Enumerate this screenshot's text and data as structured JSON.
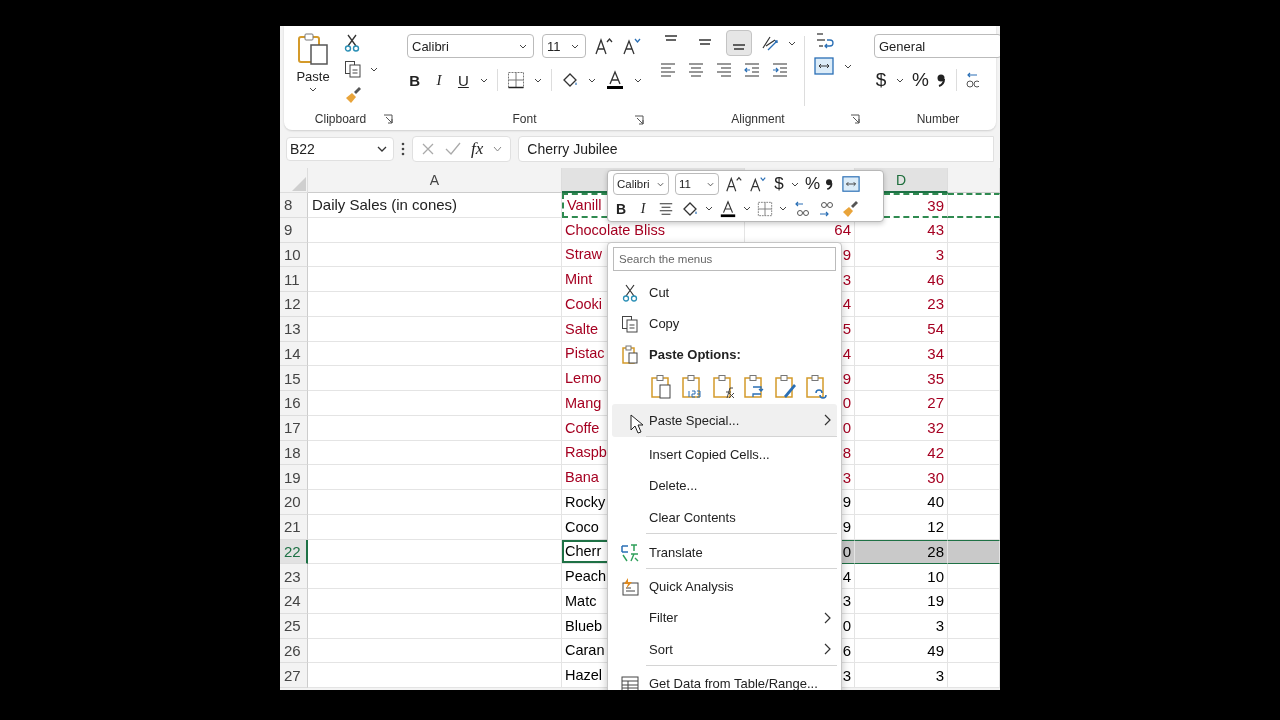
{
  "ribbon": {
    "clipboard": {
      "label": "Clipboard",
      "paste_label": "Paste"
    },
    "font": {
      "label": "Font",
      "font_name": "Calibri",
      "font_size": "11",
      "style_buttons": [
        "B",
        "I",
        "U"
      ]
    },
    "alignment": {
      "label": "Alignment",
      "vertical": [
        {
          "selected": false
        },
        {
          "selected": false
        },
        {
          "selected": true
        }
      ]
    },
    "number": {
      "label": "Number",
      "format": "General",
      "symbols": [
        "$",
        "%"
      ]
    }
  },
  "formula_bar": {
    "name_box": "B22",
    "fx": "fx",
    "content": "Cherry Jubilee"
  },
  "column_headers": [
    {
      "label": "A",
      "selected": false
    },
    {
      "selected": true
    },
    {
      "selected": false
    },
    {
      "label": "D",
      "selected": true
    },
    {
      "selected": false
    }
  ],
  "rows": [
    {
      "number": "8",
      "a": "Daily Sales (in cones)",
      "b": "Vanill",
      "d": "39",
      "color": "#a50021",
      "copied": true,
      "selected": false
    },
    {
      "number": "9",
      "b": "Chocolate Bliss",
      "c": "64",
      "d": "43",
      "color": "#a50021",
      "copied": false,
      "selected": false
    },
    {
      "number": "10",
      "b": "Straw",
      "c": "9",
      "d": "3",
      "color": "#a50021",
      "copied": false,
      "selected": false
    },
    {
      "number": "11",
      "b": "Mint",
      "c": "3",
      "d": "46",
      "color": "#a50021",
      "copied": false,
      "selected": false
    },
    {
      "number": "12",
      "b": "Cooki",
      "c": "4",
      "d": "23",
      "color": "#a50021",
      "copied": false,
      "selected": false
    },
    {
      "number": "13",
      "b": "Salte",
      "c": "5",
      "d": "54",
      "color": "#a50021",
      "copied": false,
      "selected": false
    },
    {
      "number": "14",
      "b": "Pistac",
      "c": "4",
      "d": "34",
      "color": "#a50021",
      "copied": false,
      "selected": false
    },
    {
      "number": "15",
      "b": "Lemo",
      "c": "9",
      "d": "35",
      "color": "#a50021",
      "copied": false,
      "selected": false
    },
    {
      "number": "16",
      "b": "Mang",
      "c": "0",
      "d": "27",
      "color": "#a50021",
      "copied": false,
      "selected": false
    },
    {
      "number": "17",
      "b": "Coffe",
      "c": "0",
      "d": "32",
      "color": "#a50021",
      "copied": false,
      "selected": false
    },
    {
      "number": "18",
      "b": "Raspb",
      "c": "8",
      "d": "42",
      "color": "#a50021",
      "copied": false,
      "selected": false
    },
    {
      "number": "19",
      "b": "Bana",
      "c": "3",
      "d": "30",
      "color": "#a50021",
      "copied": false,
      "selected": false
    },
    {
      "number": "20",
      "b": "Rocky",
      "c": "9",
      "d": "40",
      "color": "#000000",
      "copied": false,
      "selected": false
    },
    {
      "number": "21",
      "b": "Coco",
      "c": "9",
      "d": "12",
      "color": "#000000",
      "copied": false,
      "selected": false
    },
    {
      "number": "22",
      "b": "Cherr",
      "c": "0",
      "d": "28",
      "color": "#000000",
      "copied": false,
      "selected": true
    },
    {
      "number": "23",
      "b": "Peach",
      "c": "4",
      "d": "10",
      "color": "#000000",
      "copied": false,
      "selected": false
    },
    {
      "number": "24",
      "b": "Matc",
      "c": "3",
      "d": "19",
      "color": "#000000",
      "copied": false,
      "selected": false
    },
    {
      "number": "25",
      "b": "Blueb",
      "c": "0",
      "d": "3",
      "color": "#000000",
      "copied": false,
      "selected": false
    },
    {
      "number": "26",
      "b": "Caran",
      "c": "6",
      "d": "49",
      "color": "#000000",
      "copied": false,
      "selected": false
    },
    {
      "number": "27",
      "b": "Hazel",
      "c": "3",
      "d": "3",
      "color": "#000000",
      "copied": false,
      "selected": false
    }
  ],
  "mini_toolbar": {
    "font_name": "Calibri",
    "font_size": "11",
    "symbols": [
      "$",
      "%"
    ],
    "style_buttons": [
      "B",
      "I"
    ]
  },
  "context_menu": {
    "search_placeholder": "Search the menus",
    "items": [
      {
        "kind": "item",
        "label": "Cut",
        "submenu": false,
        "highlighted": false,
        "separator_after": false
      },
      {
        "kind": "item",
        "label": "Copy",
        "submenu": false,
        "highlighted": false,
        "separator_after": false
      },
      {
        "kind": "header",
        "label": "Paste Options:",
        "separator_after": false
      },
      {
        "kind": "paste-icons",
        "separator_after": false
      },
      {
        "kind": "item",
        "label": "Paste Special...",
        "submenu": true,
        "highlighted": true,
        "separator_after": true
      },
      {
        "kind": "item",
        "label": "Insert Copied Cells...",
        "submenu": false,
        "highlighted": false,
        "separator_after": false
      },
      {
        "kind": "item",
        "label": "Delete...",
        "submenu": false,
        "highlighted": false,
        "separator_after": false
      },
      {
        "kind": "item",
        "label": "Clear Contents",
        "submenu": false,
        "highlighted": false,
        "separator_after": true
      },
      {
        "kind": "item",
        "label": "Translate",
        "submenu": false,
        "highlighted": false,
        "separator_after": true
      },
      {
        "kind": "item",
        "label": "Quick Analysis",
        "submenu": false,
        "highlighted": false,
        "separator_after": false
      },
      {
        "kind": "item",
        "label": "Filter",
        "submenu": true,
        "highlighted": false,
        "separator_after": false
      },
      {
        "kind": "item",
        "label": "Sort",
        "submenu": true,
        "highlighted": false,
        "separator_after": true
      },
      {
        "kind": "item",
        "label": "Get Data from Table/Range...",
        "submenu": false,
        "highlighted": false,
        "separator_after": false
      }
    ]
  }
}
